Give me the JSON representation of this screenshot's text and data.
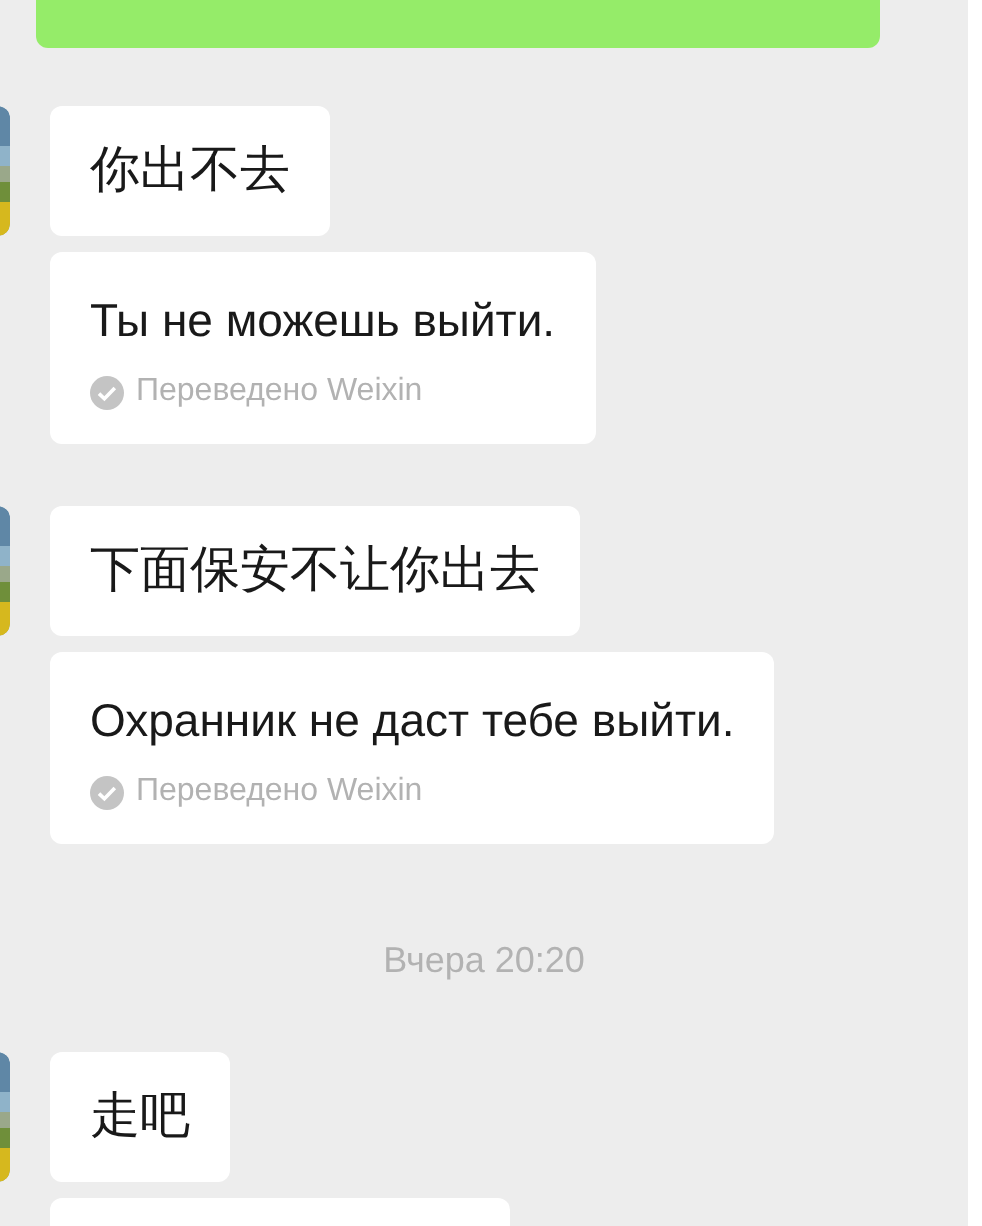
{
  "messages": [
    {
      "kind": "outgoing_cut"
    },
    {
      "kind": "incoming",
      "text": "你出不去",
      "translation": {
        "text": "Ты не можешь выйти.",
        "note": "Переведено Weixin"
      }
    },
    {
      "kind": "incoming",
      "text": "下面保安不让你出去",
      "translation": {
        "text": "Охранник не даст тебе выйти.",
        "note": "Переведено Weixin"
      }
    },
    {
      "kind": "time",
      "text": "Вчера 20:20"
    },
    {
      "kind": "incoming",
      "text": "走吧"
    },
    {
      "kind": "card_cut"
    }
  ]
}
